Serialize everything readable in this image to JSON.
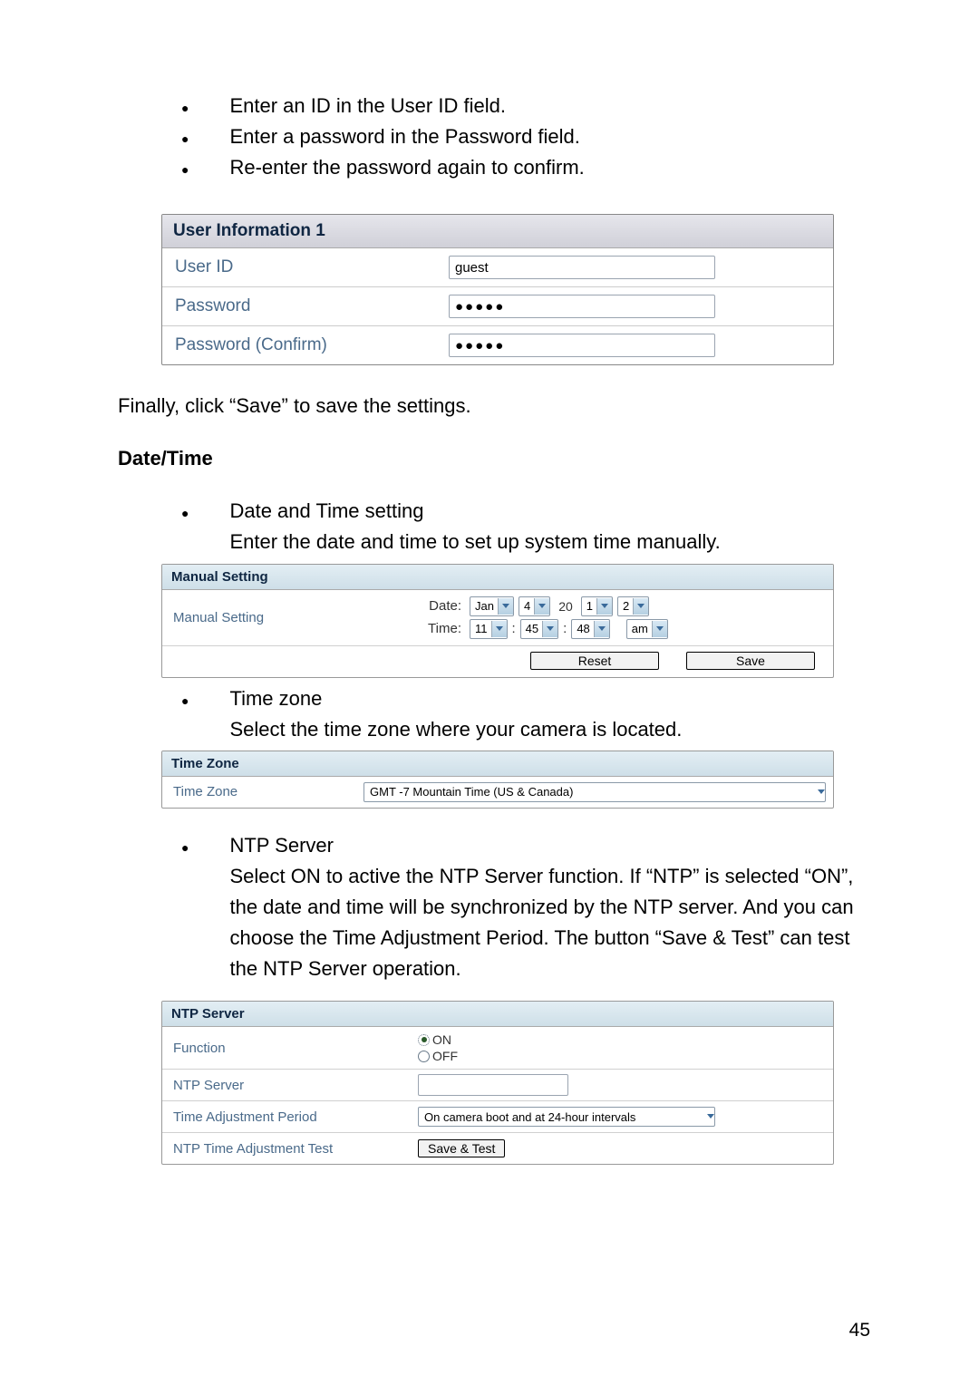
{
  "page_number": "45",
  "top_bullets": [
    "Enter an ID in the User ID field.",
    "Enter a password in the Password field.",
    "Re-enter the password again to confirm."
  ],
  "user_info_panel": {
    "header": "User Information 1",
    "rows": {
      "user_id_label": "User ID",
      "user_id_value": "guest",
      "password_label": "Password",
      "password_value": "●●●●●",
      "password_confirm_label": "Password (Confirm)",
      "password_confirm_value": "●●●●●"
    }
  },
  "after_user_info_para": "Finally, click “Save” to save the settings.",
  "date_time_heading": "Date/Time",
  "datetime_bullet": {
    "title": "Date and Time setting",
    "desc": "Enter the date and time to set up system time manually."
  },
  "manual_setting_panel": {
    "header": "Manual Setting",
    "row_label": "Manual Setting",
    "date_key": "Date:",
    "time_key": "Time:",
    "date": {
      "month": "Jan",
      "day": "4",
      "year_prefix": "20",
      "year_a": "1",
      "year_b": "2"
    },
    "time": {
      "hour": "11",
      "minute": "45",
      "second": "48",
      "ampm": "am"
    },
    "buttons": {
      "reset": "Reset",
      "save": "Save"
    }
  },
  "timezone_bullet": {
    "title": "Time zone",
    "desc": "Select the time zone where your camera is located."
  },
  "timezone_panel": {
    "header": "Time Zone",
    "row_label": "Time Zone",
    "value": "GMT -7 Mountain Time (US & Canada)"
  },
  "ntp_bullet": {
    "title": "NTP Server",
    "desc": "Select ON to active the NTP Server function. If “NTP” is selected “ON”, the date and time will be synchronized by the NTP server. And you can choose the Time Adjustment Period. The button “Save & Test” can test the NTP Server operation."
  },
  "ntp_panel": {
    "header": "NTP Server",
    "function_label": "Function",
    "on_label": "ON",
    "off_label": "OFF",
    "ntp_server_label": "NTP Server",
    "period_label": "Time Adjustment Period",
    "period_value": "On camera boot and at 24-hour intervals",
    "test_label": "NTP Time Adjustment Test",
    "test_button": "Save & Test"
  }
}
